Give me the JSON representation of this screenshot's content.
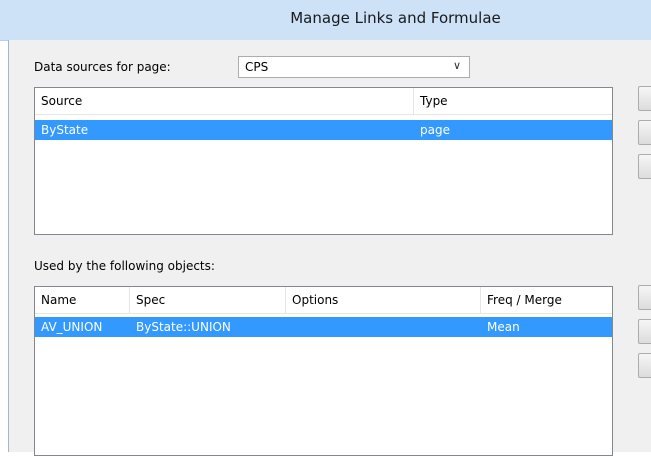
{
  "dialog": {
    "title": "Manage Links and Formulae"
  },
  "datasources": {
    "label": "Data sources for page:",
    "selected": "CPS",
    "columns": [
      "Source",
      "Type"
    ],
    "rows": [
      {
        "source": "ByState",
        "type": "page",
        "selected": true
      }
    ]
  },
  "used_by": {
    "label": "Used by the following objects:",
    "columns": [
      "Name",
      "Spec",
      "Options",
      "Freq / Merge"
    ],
    "rows": [
      {
        "name": "AV_UNION",
        "spec": "ByState::UNION",
        "options": "",
        "freq": "Mean",
        "selected": true
      }
    ]
  },
  "icons": {
    "dropdown": "chevron-down-icon"
  },
  "colors": {
    "selection": "#3399ff",
    "titlebar": "#cde1f7"
  }
}
